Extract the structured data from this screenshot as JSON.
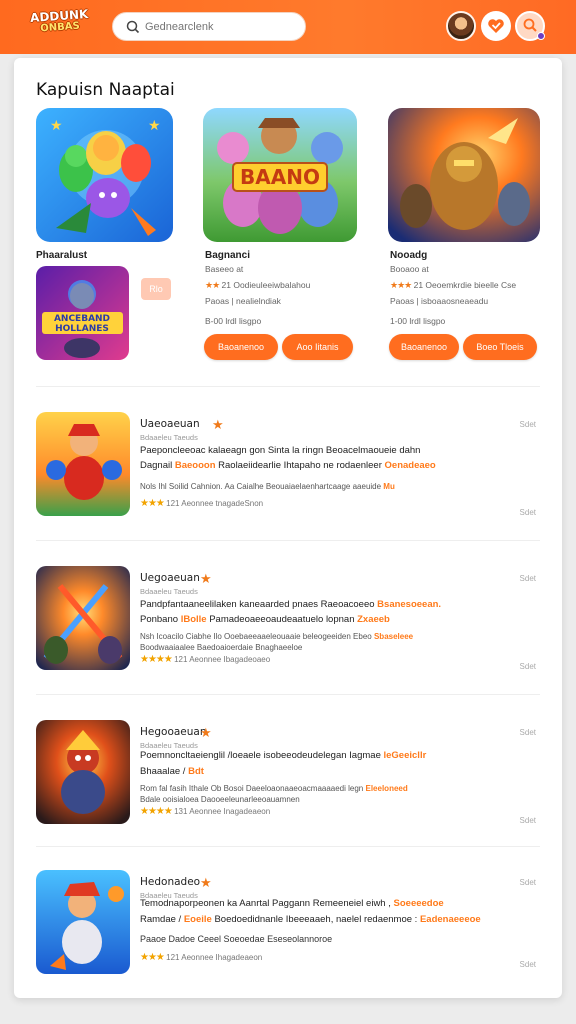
{
  "header": {
    "logo_line1": "ADDUNK",
    "logo_line2": "ONBAS",
    "search_placeholder": "Gednearclenk",
    "icons": [
      "search-icon",
      "avatar",
      "heart-icon",
      "user-search-icon"
    ],
    "accent": "#ff6d1f"
  },
  "featured": {
    "title": "Kapuisn Naaptai",
    "items": [
      {
        "name": "Phaaralust",
        "chip": "Rlo"
      },
      {
        "name": "Bagnanci",
        "sub": "Baseeo at",
        "rating": "21 Oodieuleeiwbalahou",
        "line3": "Paoas | nealielndiak",
        "line4": "B-00 lrdl lisgpo",
        "btn1": "Baoanenoo",
        "btn2": "Aoo Iitanis",
        "art_text": "BAANO"
      },
      {
        "name": "Nooadg",
        "sub": "Booaoo at",
        "rating": "21 Oeoemkrdie bieelle Cse",
        "line3": "Paoas | isboaaosneaeadu",
        "line4": "1-00 lrdl lisgpo",
        "btn1": "Baoanenoo",
        "btn2": "Boeo Tloeis"
      }
    ],
    "small_art_text": "ANCEBAND HOLLANES"
  },
  "list": [
    {
      "title": "Uaeoaeuan",
      "sub": "Bdaaeleu Taeuds",
      "time_top": "Sdet",
      "desc1": "Paeponcleeoac kalaeagn gon Sinta la ringn Beoacelmaoueie dahn",
      "desc2a": "Dagnail",
      "desc2b": "Baeooon",
      "desc2c": "Raolaeiidearlie Ihtapaho ne rodaenleer",
      "desc2d": "Oenadeaeo",
      "desc3": "Nols Ihl Soilid Cahnion. Aa Caialhe Beouaiaelaenhartcaage aaeuide",
      "desc3hl": "Mu",
      "rating": "121  Aeonnee tnagadeSnon",
      "time_bottom": "Sdet"
    },
    {
      "title": "Uegoaeuan",
      "sub": "Bdaaeleu Taeuds",
      "time_top": "Sdet",
      "desc1": "Pandpfantaaneelilaken kaneaarded pnaes Raeoacoeeo",
      "desc1hl": "Bsanesoeean.",
      "desc2a": "Ponbano",
      "desc2b": "lBolle",
      "desc2c": "Pamadeoaeeoaudeaatuelo lopnan",
      "desc2d": "Zxaeeb",
      "desc3": "Nsh  Icoacilo Ciabhe Ilo  Ooebaeeaaeleouaaie beleogeeiden  Ebeo",
      "desc3hl": "Sbaseleee",
      "desc3b": "Boodwaaiaalee Baedoaioerdaie Bnaghaeeloe",
      "rating": "121  Aeonnee Ibagadeoaeo",
      "time_bottom": "Sdet"
    },
    {
      "title": "Hegooaeuan",
      "sub": "Bdaaeleu Taeuds",
      "time_top": "Sdet",
      "desc1": "Poemnoncltaeienglil /loeaele isobeeodeudelegan Iagmae",
      "desc1hl": "leGeeicllr",
      "desc2a": "Bhaaalae / ",
      "desc2b": "Bdt",
      "desc3": "Rom  fal fasih  Ithale  Ob  Bosoi  Daeeloaonaaeoacmaaaaedi  legn",
      "desc3hl": "Eleeloneed",
      "desc3b": "Bdale  ooisialoea  Daooeeleunarleeoauamnen",
      "rating": "131  Aeonnee Inagadeaeon",
      "time_bottom": "Sdet"
    },
    {
      "title": "Hedonadeo",
      "sub": "Bdaaeleu Taeuds",
      "time_top": "Sdet",
      "desc1": "Temodnaporpeonen ka Aanrtal  Paggann",
      "desc1b": "Remeeneiel eiwh ,",
      "desc1hl": "Soeeeedoe",
      "desc2a": "Ramdae / ",
      "desc2b": "Eoeile",
      "desc2c": "Boedoedidnanle Ibeeeaaeh,  naelel redaenmoe :",
      "desc2d": "Eadenaeeeoe",
      "desc3": "Paaoe  Dadoe Ceeel  Soeoedae  Eseseolannoroe",
      "rating": "121  Aeonnee Ihagadeaeon",
      "time_bottom": "Sdet"
    }
  ]
}
